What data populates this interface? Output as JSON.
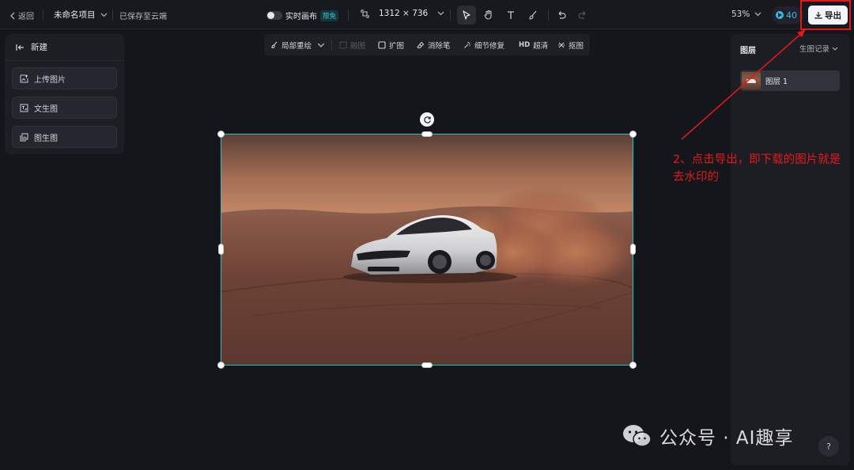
{
  "topbar": {
    "back_label": "返回",
    "project_name": "未命名项目",
    "save_status": "已保存至云端",
    "realtime_canvas_label": "实时画布",
    "realtime_badge": "限免",
    "canvas_size": "1312 × 736",
    "zoom": "53%",
    "credits": "40",
    "export_label": "导出"
  },
  "left_panel": {
    "new_label": "新建",
    "items": [
      {
        "label": "上传图片",
        "icon": "upload-image-icon"
      },
      {
        "label": "文生图",
        "icon": "text-to-image-icon"
      },
      {
        "label": "图生图",
        "icon": "image-to-image-icon"
      }
    ]
  },
  "canvas_toolbar": {
    "items": [
      {
        "label": "局部重绘",
        "icon": "brush-icon",
        "enabled": true
      },
      {
        "label": "融图",
        "icon": "merge-icon",
        "enabled": false
      },
      {
        "label": "扩图",
        "icon": "expand-icon",
        "enabled": true
      },
      {
        "label": "消除笔",
        "icon": "eraser-icon",
        "enabled": true
      },
      {
        "label": "细节修复",
        "icon": "repair-icon",
        "enabled": true
      },
      {
        "label": "超清",
        "icon": "hd-icon",
        "enabled": true,
        "prefix": "HD"
      },
      {
        "label": "抠图",
        "icon": "cutout-icon",
        "enabled": true
      }
    ]
  },
  "right_panel": {
    "title": "图层",
    "history_label": "生图记录",
    "layers": [
      {
        "name": "图层 1"
      }
    ]
  },
  "annotation": {
    "text": "2、点击导出，即下载的图片就是去水印的",
    "color": "#e11b1b"
  },
  "watermark": {
    "text": "公众号 · AI趣享"
  },
  "help": {
    "label": "?"
  },
  "colors": {
    "accent": "#20c4c8",
    "credit": "#3fb8e6",
    "annotation_red": "#e01818"
  }
}
